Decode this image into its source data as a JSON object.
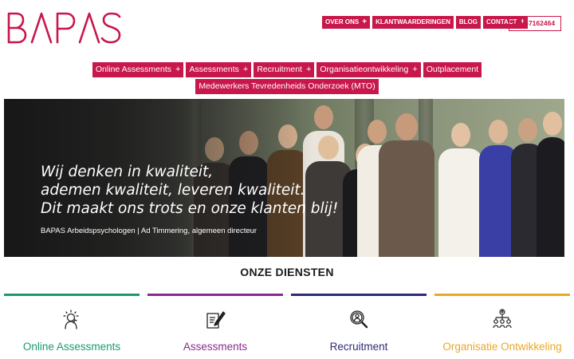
{
  "brand": {
    "logo_text": "BAPAS",
    "color": "#c8174a"
  },
  "top_nav": {
    "items": [
      {
        "label": "OVER ONS",
        "has_submenu": true
      },
      {
        "label": "KLANTWAARDERINGEN",
        "has_submenu": false
      },
      {
        "label": "BLOG",
        "has_submenu": false
      },
      {
        "label": "CONTACT",
        "has_submenu": true
      }
    ],
    "phone": "020-7162464",
    "plus_symbol": "+"
  },
  "main_nav": {
    "row1": [
      {
        "label": "Online Assessments",
        "has_submenu": true
      },
      {
        "label": "Assessments",
        "has_submenu": true
      },
      {
        "label": "Recruitment",
        "has_submenu": true
      },
      {
        "label": "Organisatieontwikkeling",
        "has_submenu": true
      },
      {
        "label": "Outplacement",
        "has_submenu": false
      }
    ],
    "row2": [
      {
        "label": "Medewerkers Tevredenheids Onderzoek (MTO)",
        "has_submenu": false
      }
    ]
  },
  "hero": {
    "quote_lines": [
      "Wij denken in kwaliteit,",
      "ademen kwaliteit, leveren kwaliteit.",
      "Dit maakt ons trots en onze klanten blij!"
    ],
    "attribution": "BAPAS Arbeidspsychologen | Ad Timmering, algemeen directeur"
  },
  "services": {
    "title": "ONZE DIENSTEN",
    "items": [
      {
        "label": "Online Assessments",
        "color": "#1a9a6a",
        "icon": "thinking-person-icon"
      },
      {
        "label": "Assessments",
        "color": "#8a2a8e",
        "icon": "document-pen-icon"
      },
      {
        "label": "Recruitment",
        "color": "#2e2a7a",
        "icon": "magnifier-person-icon"
      },
      {
        "label": "Organisatie Ontwikkeling",
        "color": "#e8a82a",
        "icon": "org-chart-icon"
      }
    ]
  }
}
